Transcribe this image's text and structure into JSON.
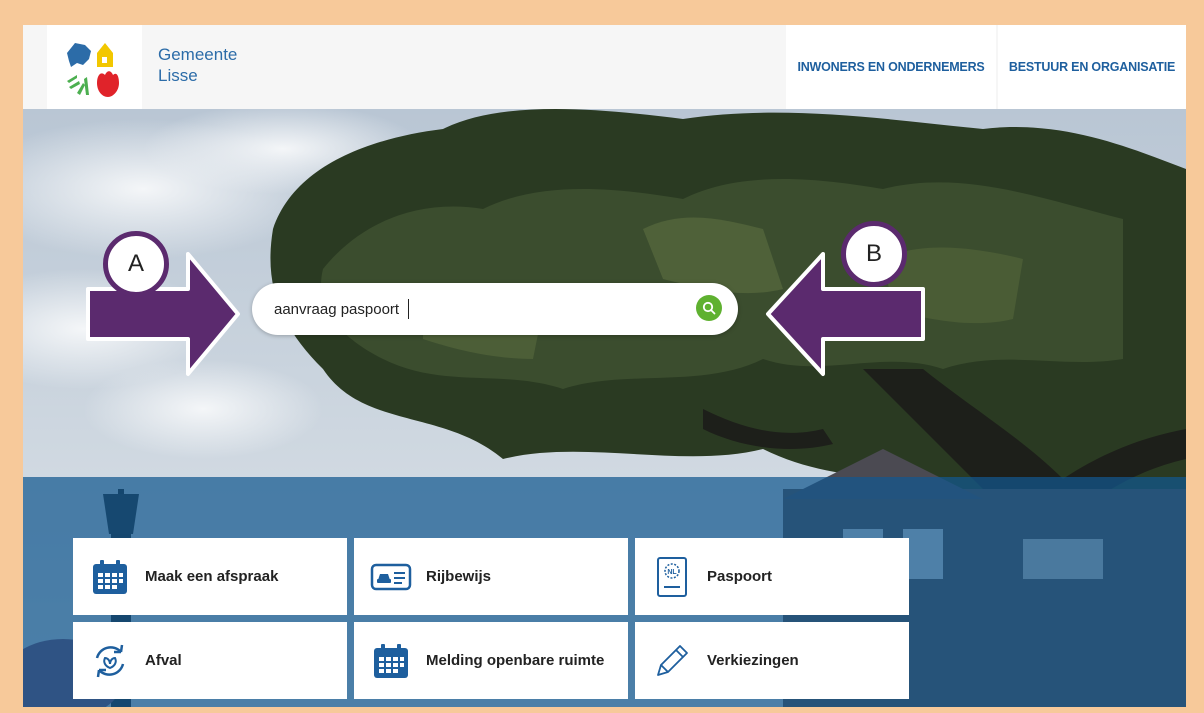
{
  "header": {
    "site_name_line1": "Gemeente",
    "site_name_line2": "Lisse",
    "nav": [
      "INWONERS EN ONDERNEMERS",
      "BESTUUR EN ORGANISATIE"
    ]
  },
  "search": {
    "value": "aanvraag paspoort",
    "button_icon": "search-icon"
  },
  "callouts": {
    "a": "A",
    "b": "B"
  },
  "tiles": [
    {
      "label": "Maak een afspraak",
      "icon": "calendar-icon"
    },
    {
      "label": "Rijbewijs",
      "icon": "drivers-license-icon"
    },
    {
      "label": "Paspoort",
      "icon": "passport-icon"
    },
    {
      "label": "Afval",
      "icon": "recycle-icon"
    },
    {
      "label": "Melding openbare ruimte",
      "icon": "calendar-icon"
    },
    {
      "label": "Verkiezingen",
      "icon": "pencil-icon"
    }
  ],
  "colors": {
    "brand_blue": "#1e5f9e",
    "search_green": "#5fb130",
    "arrow_purple": "#5b2a6e",
    "frame_peach": "#f7c99a"
  }
}
